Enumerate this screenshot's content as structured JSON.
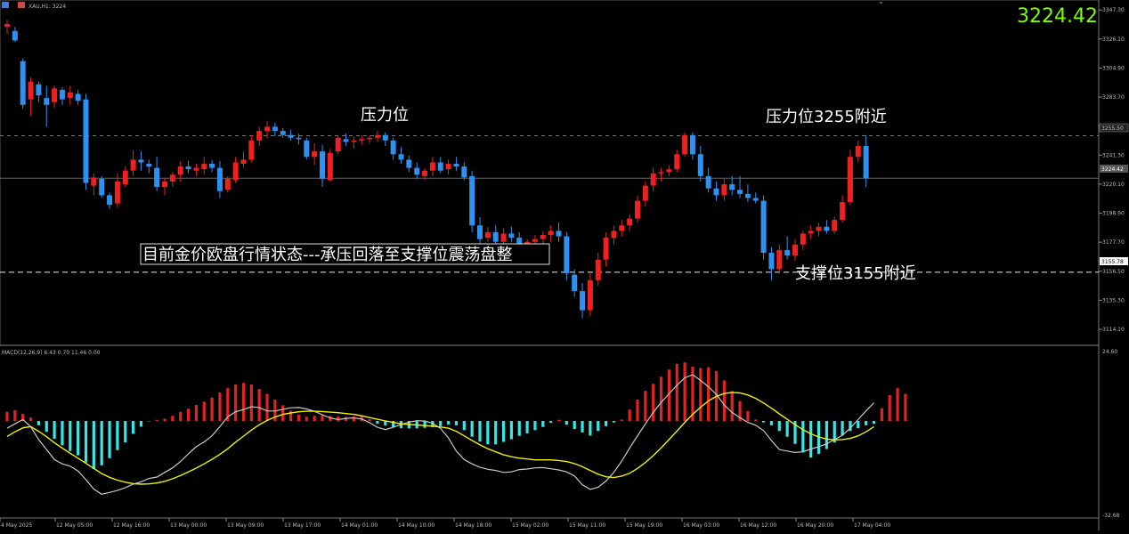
{
  "window": {
    "symbol_label": "XAU,H1: 3224",
    "current_price": "3224.42"
  },
  "annotations": {
    "resistance_left": "压力位",
    "resistance_right": "压力位3255附近",
    "support_right": "支撑位3155附近",
    "status_banner": "目前金价欧盘行情状态---承压回落至支撑位震荡盘整"
  },
  "price_tags": {
    "resistance_line": "3255.50",
    "current_line": "3224.42",
    "support_line": "3155.78"
  },
  "colors": {
    "bull": "#f02020",
    "bear": "#2e90f0",
    "hist_pos": "#e52222",
    "hist_neg": "#33e8e8",
    "macd_line": "#c8c8c8",
    "signal_line": "#f0f000",
    "price_text": "#7CFC00",
    "grid": "#3a3a3a"
  },
  "chart_data": [
    {
      "type": "candlestick",
      "series_name": "XAU,H1",
      "y_ticks": [
        "3347.30",
        "3326.10",
        "3304.90",
        "3283.70",
        "3262.50",
        "3241.30",
        "3220.10",
        "3198.90",
        "3177.70",
        "3156.50",
        "3135.30",
        "3114.10"
      ],
      "ylim": [
        3105,
        3352
      ],
      "x_ticks": [
        "4 May 2025",
        "12 May 05:00",
        "12 May 16:00",
        "13 May 00:00",
        "13 May 09:00",
        "13 May 17:00",
        "14 May 01:00",
        "14 May 10:00",
        "14 May 18:00",
        "15 May 02:00",
        "15 May 11:00",
        "15 May 19:00",
        "16 May 03:00",
        "16 May 12:00",
        "16 May 20:00",
        "17 May 04:00"
      ],
      "horizontal_levels": [
        3255.5,
        3224.42,
        3155.78
      ],
      "ohlc": [
        [
          3335.0,
          3340.0,
          3330.0,
          3337.0
        ],
        [
          3332.0,
          3335.0,
          3324.0,
          3325.0
        ],
        [
          3310.0,
          3312.0,
          3275.0,
          3278.0
        ],
        [
          3282.0,
          3298.0,
          3270.0,
          3295.0
        ],
        [
          3293.0,
          3295.0,
          3280.0,
          3285.0
        ],
        [
          3283.0,
          3292.0,
          3262.0,
          3278.0
        ],
        [
          3280.0,
          3292.0,
          3276.0,
          3290.0
        ],
        [
          3289.0,
          3291.0,
          3278.0,
          3282.0
        ],
        [
          3283.0,
          3292.0,
          3278.0,
          3287.0
        ],
        [
          3286.0,
          3289.0,
          3278.0,
          3281.0
        ],
        [
          3282.0,
          3286.0,
          3216.0,
          3221.0
        ],
        [
          3219.0,
          3228.0,
          3212.0,
          3225.0
        ],
        [
          3224.0,
          3226.0,
          3210.0,
          3212.0
        ],
        [
          3212.0,
          3214.0,
          3202.0,
          3205.0
        ],
        [
          3206.0,
          3228.0,
          3203.0,
          3222.0
        ],
        [
          3220.0,
          3233.0,
          3218.0,
          3230.0
        ],
        [
          3230.0,
          3245.0,
          3226.0,
          3238.0
        ],
        [
          3238.0,
          3244.0,
          3230.0,
          3236.0
        ],
        [
          3235.0,
          3238.0,
          3228.0,
          3233.0
        ],
        [
          3232.0,
          3240.0,
          3215.0,
          3218.0
        ],
        [
          3218.0,
          3225.0,
          3212.0,
          3222.0
        ],
        [
          3222.0,
          3229.0,
          3218.0,
          3227.0
        ],
        [
          3227.0,
          3237.0,
          3222.0,
          3233.0
        ],
        [
          3233.0,
          3237.0,
          3228.0,
          3231.0
        ],
        [
          3230.0,
          3235.0,
          3226.0,
          3232.0
        ],
        [
          3231.0,
          3240.0,
          3227.0,
          3235.0
        ],
        [
          3235.0,
          3238.0,
          3229.0,
          3232.0
        ],
        [
          3232.0,
          3237.0,
          3210.0,
          3215.0
        ],
        [
          3216.0,
          3226.0,
          3214.0,
          3224.0
        ],
        [
          3223.0,
          3240.0,
          3221.0,
          3236.0
        ],
        [
          3235.0,
          3244.0,
          3232.0,
          3238.0
        ],
        [
          3238.0,
          3256.0,
          3236.0,
          3252.0
        ],
        [
          3252.0,
          3262.0,
          3248.0,
          3259.0
        ],
        [
          3259.0,
          3266.0,
          3254.0,
          3262.0
        ],
        [
          3262.0,
          3265.0,
          3255.0,
          3259.0
        ],
        [
          3259.0,
          3261.0,
          3254.0,
          3256.0
        ],
        [
          3256.0,
          3260.0,
          3252.0,
          3254.0
        ],
        [
          3254.0,
          3257.0,
          3249.0,
          3253.0
        ],
        [
          3252.0,
          3254.0,
          3238.0,
          3240.0
        ],
        [
          3240.0,
          3250.0,
          3234.0,
          3244.0
        ],
        [
          3244.0,
          3249.0,
          3218.0,
          3224.0
        ],
        [
          3223.0,
          3246.0,
          3222.0,
          3243.0
        ],
        [
          3244.0,
          3256.0,
          3242.0,
          3254.0
        ],
        [
          3253.0,
          3257.0,
          3248.0,
          3251.0
        ],
        [
          3251.0,
          3255.0,
          3246.0,
          3252.0
        ],
        [
          3252.0,
          3256.0,
          3249.0,
          3253.0
        ],
        [
          3253.0,
          3256.0,
          3250.0,
          3254.0
        ],
        [
          3254.0,
          3259.0,
          3251.0,
          3256.0
        ],
        [
          3256.0,
          3258.0,
          3248.0,
          3252.0
        ],
        [
          3252.0,
          3254.0,
          3238.0,
          3242.0
        ],
        [
          3242.0,
          3247.0,
          3235.0,
          3238.0
        ],
        [
          3238.0,
          3241.0,
          3229.0,
          3232.0
        ],
        [
          3232.0,
          3236.0,
          3224.0,
          3227.0
        ],
        [
          3226.0,
          3232.0,
          3223.0,
          3230.0
        ],
        [
          3230.0,
          3240.0,
          3226.0,
          3236.0
        ],
        [
          3236.0,
          3240.0,
          3228.0,
          3230.0
        ],
        [
          3231.0,
          3238.0,
          3227.0,
          3235.0
        ],
        [
          3235.0,
          3240.0,
          3230.0,
          3233.0
        ],
        [
          3233.0,
          3236.0,
          3223.0,
          3225.0
        ],
        [
          3226.0,
          3230.0,
          3185.0,
          3190.0
        ],
        [
          3190.0,
          3196.0,
          3176.0,
          3180.0
        ],
        [
          3181.0,
          3189.0,
          3178.0,
          3185.0
        ],
        [
          3185.0,
          3190.0,
          3176.0,
          3178.0
        ],
        [
          3178.0,
          3188.0,
          3175.0,
          3184.0
        ],
        [
          3184.0,
          3189.0,
          3178.0,
          3181.0
        ],
        [
          3181.0,
          3185.0,
          3168.0,
          3170.0
        ],
        [
          3170.0,
          3180.0,
          3167.0,
          3178.0
        ],
        [
          3178.0,
          3183.0,
          3172.0,
          3180.0
        ],
        [
          3180.0,
          3186.0,
          3175.0,
          3183.0
        ],
        [
          3183.0,
          3190.0,
          3178.0,
          3186.0
        ],
        [
          3186.0,
          3192.0,
          3178.0,
          3182.0
        ],
        [
          3182.0,
          3185.0,
          3150.0,
          3155.0
        ],
        [
          3154.0,
          3158.0,
          3138.0,
          3142.0
        ],
        [
          3142.0,
          3148.0,
          3122.0,
          3128.0
        ],
        [
          3128.0,
          3155.0,
          3124.0,
          3150.0
        ],
        [
          3150.0,
          3170.0,
          3146.0,
          3165.0
        ],
        [
          3165.0,
          3185.0,
          3160.0,
          3181.0
        ],
        [
          3181.0,
          3190.0,
          3176.0,
          3186.0
        ],
        [
          3186.0,
          3194.0,
          3182.0,
          3190.0
        ],
        [
          3190.0,
          3198.0,
          3186.0,
          3195.0
        ],
        [
          3195.0,
          3212.0,
          3192.0,
          3208.0
        ],
        [
          3208.0,
          3222.0,
          3204.0,
          3219.0
        ],
        [
          3219.0,
          3232.0,
          3215.0,
          3228.0
        ],
        [
          3228.0,
          3232.0,
          3222.0,
          3229.0
        ],
        [
          3229.0,
          3234.0,
          3226.0,
          3231.0
        ],
        [
          3231.0,
          3245.0,
          3229.0,
          3242.0
        ],
        [
          3242.0,
          3258.0,
          3240.0,
          3256.0
        ],
        [
          3256.0,
          3258.0,
          3238.0,
          3242.0
        ],
        [
          3242.0,
          3248.0,
          3222.0,
          3226.0
        ],
        [
          3226.0,
          3232.0,
          3214.0,
          3217.0
        ],
        [
          3217.0,
          3222.0,
          3208.0,
          3212.0
        ],
        [
          3212.0,
          3224.0,
          3208.0,
          3220.0
        ],
        [
          3220.0,
          3226.0,
          3212.0,
          3216.0
        ],
        [
          3216.0,
          3226.0,
          3210.0,
          3213.0
        ],
        [
          3213.0,
          3220.0,
          3207.0,
          3210.0
        ],
        [
          3210.0,
          3214.0,
          3206.0,
          3208.0
        ],
        [
          3208.0,
          3212.0,
          3165.0,
          3170.0
        ],
        [
          3170.0,
          3174.0,
          3150.0,
          3158.0
        ],
        [
          3158.0,
          3176.0,
          3155.0,
          3172.0
        ],
        [
          3172.0,
          3182.0,
          3165.0,
          3168.0
        ],
        [
          3168.0,
          3180.0,
          3164.0,
          3176.0
        ],
        [
          3176.0,
          3186.0,
          3172.0,
          3184.0
        ],
        [
          3184.0,
          3190.0,
          3180.0,
          3186.0
        ],
        [
          3186.0,
          3192.0,
          3182.0,
          3189.0
        ],
        [
          3189.0,
          3194.0,
          3184.0,
          3186.0
        ],
        [
          3186.0,
          3196.0,
          3184.0,
          3194.0
        ],
        [
          3194.0,
          3212.0,
          3192.0,
          3207.0
        ],
        [
          3207.0,
          3245.0,
          3205.0,
          3240.0
        ],
        [
          3240.0,
          3252.0,
          3236.0,
          3248.0
        ],
        [
          3248.0,
          3256.0,
          3218.0,
          3224.42
        ]
      ]
    },
    {
      "type": "macd",
      "header": "MACD(12,26,9) 6.43 0.70 11.46 0.00",
      "y_ticks": [
        "24.60",
        "-32.68"
      ],
      "ylim": [
        -32.68,
        24.6
      ],
      "histogram": [
        3.2,
        3.8,
        2.5,
        1.2,
        -1.5,
        -3.8,
        -6.2,
        -8.5,
        -10.5,
        -12.0,
        -14.5,
        -16.8,
        -15.5,
        -13.0,
        -10.2,
        -7.5,
        -4.5,
        -2.0,
        0.0,
        0.4,
        0.8,
        1.8,
        3.2,
        4.3,
        5.6,
        6.8,
        8.2,
        10.0,
        11.5,
        12.8,
        13.3,
        12.8,
        11.2,
        9.5,
        7.5,
        5.5,
        3.6,
        2.2,
        1.5,
        1.8,
        2.1,
        1.8,
        1.6,
        1.4,
        1.6,
        2.0,
        0.6,
        -1.0,
        -1.6,
        -2.1,
        -2.5,
        -2.6,
        -2.6,
        -2.4,
        -2.2,
        -1.8,
        -1.2,
        -1.5,
        -3.2,
        -5.5,
        -7.2,
        -8.1,
        -8.2,
        -7.3,
        -6.4,
        -5.2,
        -4.3,
        -3.2,
        -2.1,
        -0.6,
        0.4,
        -1.3,
        -2.8,
        -4.0,
        -5.1,
        -3.5,
        -1.8,
        -0.5,
        0.5,
        4.0,
        7.5,
        10.5,
        13.0,
        15.5,
        18.0,
        20.0,
        20.5,
        19.0,
        18.5,
        18.8,
        17.5,
        14.2,
        10.5,
        7.0,
        3.5,
        0.5,
        -0.5,
        -1.5,
        -3.5,
        -5.5,
        -8.0,
        -11.0,
        -12.8,
        -11.5,
        -9.8,
        -7.5,
        -5.0,
        -3.5,
        -2.5,
        -1.5,
        -1.0,
        4.5,
        9.0,
        11.5,
        9.5
      ],
      "macd_line": [
        -2.5,
        -1.0,
        0.5,
        -2.0,
        -6.5,
        -10.0,
        -13.5,
        -15.0,
        -15.8,
        -17.5,
        -20.5,
        -23.8,
        -25.6,
        -25.0,
        -24.3,
        -23.3,
        -22.1,
        -21.3,
        -20.1,
        -19.6,
        -18.0,
        -16.4,
        -14.2,
        -11.5,
        -9.0,
        -7.3,
        -5.2,
        -2.0,
        1.5,
        3.2,
        4.0,
        5.0,
        4.7,
        3.5,
        3.5,
        4.1,
        4.6,
        4.7,
        4.2,
        3.4,
        2.2,
        1.1,
        0.5,
        0.9,
        1.1,
        0.7,
        -0.6,
        -2.2,
        -3.0,
        -2.2,
        -1.2,
        -0.4,
        0.1,
        0.0,
        -0.8,
        -2.6,
        -5.9,
        -10.5,
        -13.5,
        -15.0,
        -16.2,
        -16.9,
        -17.3,
        -18.0,
        -17.8,
        -17.0,
        -16.8,
        -16.4,
        -16.3,
        -16.7,
        -17.1,
        -17.8,
        -19.2,
        -22.3,
        -23.9,
        -23.2,
        -21.0,
        -18.0,
        -14.0,
        -9.5,
        -5.2,
        -1.0,
        3.0,
        6.5,
        9.5,
        12.5,
        15.1,
        16.2,
        14.2,
        12.0,
        9.3,
        5.6,
        3.0,
        1.2,
        -0.5,
        -1.5,
        -3.4,
        -6.8,
        -10.0,
        -10.5,
        -11.0,
        -10.8,
        -9.8,
        -9.0,
        -8.0,
        -6.5,
        -5.0,
        -2.5,
        0.5,
        3.5,
        6.4
      ],
      "signal_line": [
        -5.4,
        -3.8,
        -2.4,
        -2.0,
        -3.6,
        -5.5,
        -7.6,
        -9.5,
        -11.3,
        -13.0,
        -14.8,
        -16.6,
        -18.4,
        -19.7,
        -20.7,
        -21.4,
        -21.9,
        -22.1,
        -22.0,
        -21.7,
        -21.1,
        -20.2,
        -19.1,
        -17.8,
        -16.5,
        -15.0,
        -13.4,
        -11.7,
        -9.7,
        -7.4,
        -5.3,
        -3.2,
        -1.3,
        0.2,
        1.4,
        2.3,
        2.8,
        3.2,
        3.4,
        3.4,
        3.3,
        3.1,
        2.9,
        2.6,
        2.3,
        1.8,
        1.2,
        0.6,
        0.0,
        -0.5,
        -1.0,
        -1.2,
        -1.4,
        -1.6,
        -1.8,
        -2.1,
        -2.5,
        -3.6,
        -5.2,
        -6.8,
        -8.3,
        -9.7,
        -10.8,
        -11.8,
        -12.5,
        -13.0,
        -13.3,
        -13.6,
        -13.6,
        -13.6,
        -13.8,
        -14.2,
        -14.9,
        -16.0,
        -17.3,
        -18.6,
        -19.5,
        -19.8,
        -19.3,
        -18.3,
        -16.6,
        -14.5,
        -12.1,
        -9.4,
        -6.5,
        -3.5,
        -0.5,
        2.3,
        4.8,
        7.0,
        8.6,
        9.6,
        10.0,
        9.8,
        9.1,
        7.9,
        6.3,
        4.5,
        2.5,
        0.6,
        -1.3,
        -3.0,
        -4.5,
        -5.6,
        -6.3,
        -6.6,
        -6.5,
        -6.1,
        -5.2,
        -3.8,
        -2.0
      ]
    }
  ]
}
